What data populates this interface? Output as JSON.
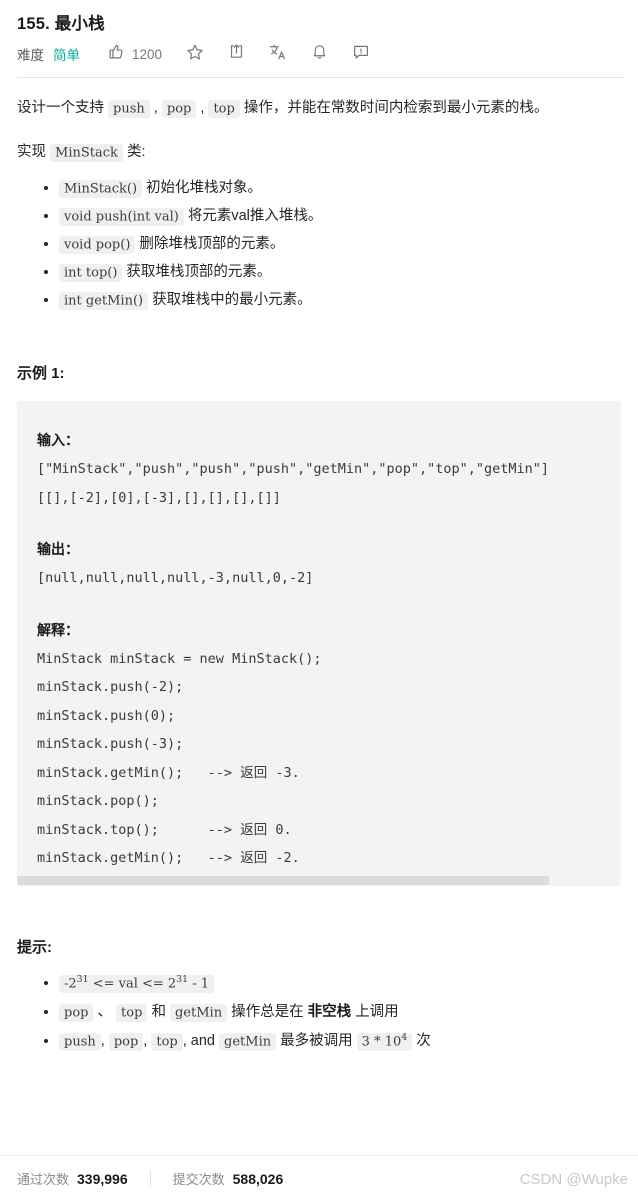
{
  "header": {
    "title": "155. 最小栈",
    "difficulty_label": "难度",
    "difficulty_value": "简单",
    "difficulty_color": "#00af9b",
    "likes": "1200",
    "icons": [
      "thumbs-up-icon",
      "star-icon",
      "share-icon",
      "translate-icon",
      "bell-icon",
      "feedback-icon"
    ]
  },
  "description": {
    "p1_a": "设计一个支持 ",
    "p1_code1": "push",
    "p1_b": " , ",
    "p1_code2": "pop",
    "p1_c": " , ",
    "p1_code3": "top",
    "p1_d": " 操作，并能在常数时间内检索到最小元素的栈。",
    "p2_a": "实现 ",
    "p2_code": "MinStack",
    "p2_b": " 类:"
  },
  "methods": [
    {
      "code": "MinStack()",
      "text": " 初始化堆栈对象。"
    },
    {
      "code": "void push(int val)",
      "text": " 将元素val推入堆栈。"
    },
    {
      "code": "void pop()",
      "text": " 删除堆栈顶部的元素。"
    },
    {
      "code": "int top()",
      "text": " 获取堆栈顶部的元素。"
    },
    {
      "code": "int getMin()",
      "text": " 获取堆栈中的最小元素。"
    }
  ],
  "example": {
    "heading": "示例 1:",
    "input_label": "输入：",
    "input_line1": "[\"MinStack\",\"push\",\"push\",\"push\",\"getMin\",\"pop\",\"top\",\"getMin\"]",
    "input_line2": "[[],[-2],[0],[-3],[],[],[],[]]",
    "output_label": "输出：",
    "output_line": "[null,null,null,null,-3,null,0,-2]",
    "explain_label": "解释：",
    "explain_lines": [
      "MinStack minStack = new MinStack();",
      "minStack.push(-2);",
      "minStack.push(0);",
      "minStack.push(-3);",
      "minStack.getMin();   --> 返回 -3.",
      "minStack.pop();",
      "minStack.top();      --> 返回 0.",
      "minStack.getMin();   --> 返回 -2."
    ]
  },
  "hints": {
    "heading": "提示:",
    "item1": {
      "code_a": "-2",
      "sup_a": "31",
      "mid": " <= val <= 2",
      "sup_b": "31",
      "code_b": " - 1"
    },
    "item2": {
      "c1": "pop",
      "s1": " 、 ",
      "c2": "top",
      "s2": " 和 ",
      "c3": "getMin",
      "s3": " 操作总是在 ",
      "bold": "非空栈",
      "s4": " 上调用"
    },
    "item3": {
      "c1": "push",
      "s1": ", ",
      "c2": "pop",
      "s2": ", ",
      "c3": "top",
      "s3": ", and ",
      "c4": "getMin",
      "s4": " 最多被调用 ",
      "c5_a": "3 * 10",
      "c5_sup": "4",
      "s5": " 次"
    }
  },
  "footer": {
    "accepted_label": "通过次数",
    "accepted_value": "339,996",
    "submissions_label": "提交次数",
    "submissions_value": "588,026",
    "watermark": "CSDN @Wupke"
  }
}
